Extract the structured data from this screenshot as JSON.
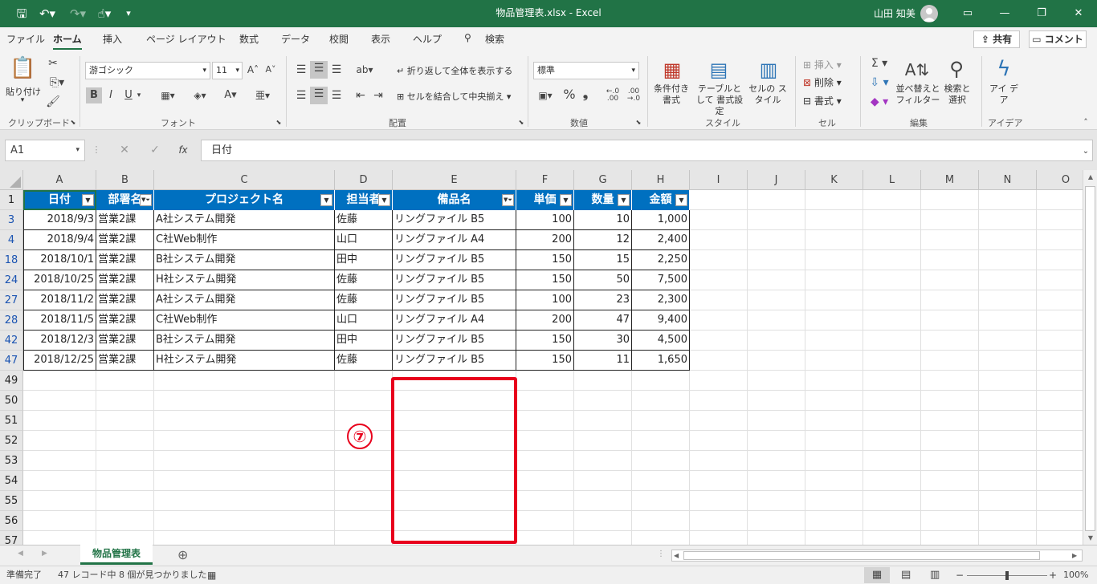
{
  "title_bar": {
    "title": "物品管理表.xlsx  -  Excel",
    "user": "山田 知美",
    "save_icon": "save-icon",
    "undo_icon": "undo-icon",
    "redo_icon": "redo-icon",
    "touch_icon": "touch-mode-icon",
    "customize": "▾"
  },
  "menu": {
    "tabs": [
      "ファイル",
      "ホーム",
      "挿入",
      "ページ レイアウト",
      "数式",
      "データ",
      "校閲",
      "表示",
      "ヘルプ"
    ],
    "search": "検索",
    "share": "共有",
    "comment": "コメント"
  },
  "ribbon": {
    "clipboard": {
      "paste": "貼り付け",
      "label": "クリップボード"
    },
    "font": {
      "name": "游ゴシック",
      "size": "11",
      "bold": "B",
      "italic": "I",
      "underline": "U",
      "label": "フォント"
    },
    "alignment": {
      "wrap": "折り返して全体を表示する",
      "merge": "セルを結合して中央揃え",
      "label": "配置"
    },
    "number": {
      "format": "標準",
      "percent": "%",
      "comma": "❟",
      "label": "数値"
    },
    "styles": {
      "conditional": "条件付き 書式",
      "table": "テーブルとして 書式設定",
      "cell": "セルの スタイル",
      "label": "スタイル"
    },
    "cells": {
      "insert": "挿入",
      "delete": "削除",
      "format": "書式",
      "label": "セル"
    },
    "editing": {
      "sort": "並べ替えと フィルター",
      "find": "検索と 選択",
      "label": "編集"
    },
    "ideas": {
      "ideas": "アイ デア",
      "label": "アイデア"
    }
  },
  "formula_bar": {
    "name_box": "A1",
    "fx": "fx",
    "content": "日付"
  },
  "columns": [
    "A",
    "B",
    "C",
    "D",
    "E",
    "F",
    "G",
    "H",
    "I",
    "J",
    "K",
    "L",
    "M",
    "N",
    "O"
  ],
  "headers": [
    "日付",
    "部署名",
    "プロジェクト名",
    "担当者",
    "備品名",
    "単価",
    "数量",
    "金額"
  ],
  "rows": [
    {
      "num": "3",
      "date": "2018/9/3",
      "dept": "営業2課",
      "project": "A社システム開発",
      "person": "佐藤",
      "item": "リングファイル B5",
      "price": "100",
      "qty": "10",
      "amount": "1,000"
    },
    {
      "num": "4",
      "date": "2018/9/4",
      "dept": "営業2課",
      "project": "C社Web制作",
      "person": "山口",
      "item": "リングファイル A4",
      "price": "200",
      "qty": "12",
      "amount": "2,400"
    },
    {
      "num": "18",
      "date": "2018/10/1",
      "dept": "営業2課",
      "project": "B社システム開発",
      "person": "田中",
      "item": "リングファイル B5",
      "price": "150",
      "qty": "15",
      "amount": "2,250"
    },
    {
      "num": "24",
      "date": "2018/10/25",
      "dept": "営業2課",
      "project": "H社システム開発",
      "person": "佐藤",
      "item": "リングファイル B5",
      "price": "150",
      "qty": "50",
      "amount": "7,500"
    },
    {
      "num": "27",
      "date": "2018/11/2",
      "dept": "営業2課",
      "project": "A社システム開発",
      "person": "佐藤",
      "item": "リングファイル B5",
      "price": "100",
      "qty": "23",
      "amount": "2,300"
    },
    {
      "num": "28",
      "date": "2018/11/5",
      "dept": "営業2課",
      "project": "C社Web制作",
      "person": "山口",
      "item": "リングファイル A4",
      "price": "200",
      "qty": "47",
      "amount": "9,400"
    },
    {
      "num": "42",
      "date": "2018/12/3",
      "dept": "営業2課",
      "project": "B社システム開発",
      "person": "田中",
      "item": "リングファイル B5",
      "price": "150",
      "qty": "30",
      "amount": "4,500"
    },
    {
      "num": "47",
      "date": "2018/12/25",
      "dept": "営業2課",
      "project": "H社システム開発",
      "person": "佐藤",
      "item": "リングファイル B5",
      "price": "150",
      "qty": "11",
      "amount": "1,650"
    }
  ],
  "empty_rows": [
    "49",
    "50",
    "51",
    "52",
    "53",
    "54",
    "55",
    "56",
    "57"
  ],
  "header_row_num": "1",
  "annotation": "⑦",
  "sheet": {
    "tab": "物品管理表",
    "add": "⊕"
  },
  "status": {
    "ready": "準備完了",
    "filter_info": "47 レコード中 8 個が見つかりました",
    "zoom": "100%"
  },
  "colors": {
    "excel_green": "#217346",
    "table_header": "#0070c0",
    "highlight": "#e8001c"
  }
}
